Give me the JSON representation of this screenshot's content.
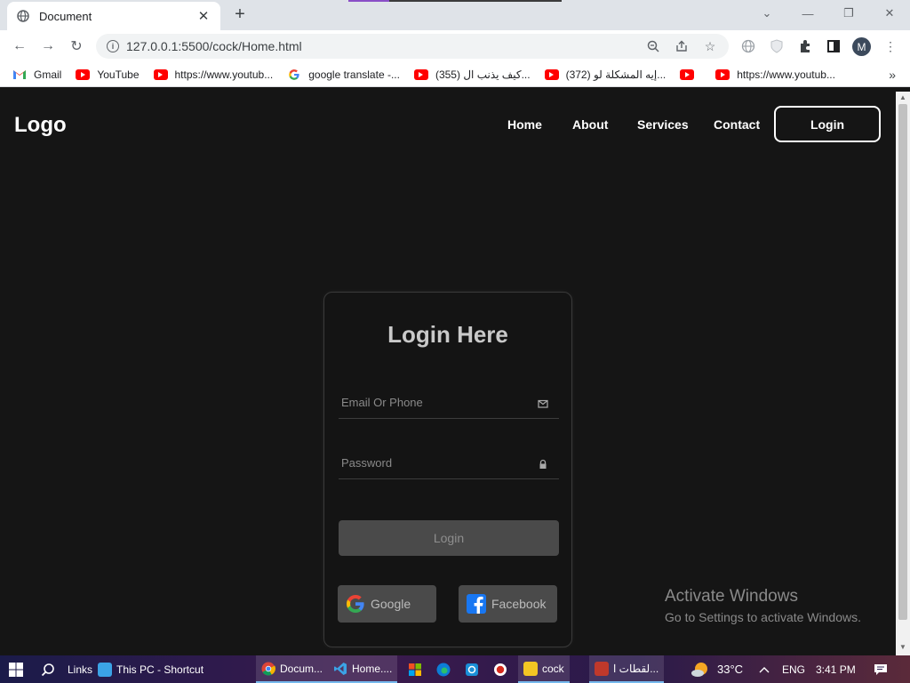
{
  "browser": {
    "tab_title": "Document",
    "url": "127.0.0.1:5500/cock/Home.html",
    "avatar_letter": "M",
    "bookmarks": [
      {
        "label": "Gmail",
        "icon": "gmail-icon"
      },
      {
        "label": "YouTube",
        "icon": "youtube-icon"
      },
      {
        "label": "https://www.youtub...",
        "icon": "youtube-icon"
      },
      {
        "label": "google translate -...",
        "icon": "google-icon"
      },
      {
        "label": "(355) كيف يذنب ال...",
        "icon": "youtube-icon"
      },
      {
        "label": "(372) إيه المشكلة لو...",
        "icon": "youtube-icon"
      },
      {
        "label": "",
        "icon": "youtube-icon"
      },
      {
        "label": "https://www.youtub...",
        "icon": "youtube-icon"
      }
    ]
  },
  "page": {
    "logo": "Logo",
    "nav": [
      "Home",
      "About",
      "Services",
      "Contact"
    ],
    "nav_login": "Login",
    "card": {
      "title": "Login Here",
      "email_placeholder": "Email Or Phone",
      "password_placeholder": "Password",
      "login_button": "Login",
      "google_label": "Google",
      "facebook_label": "Facebook"
    },
    "watermark": {
      "line1": "Activate Windows",
      "line2": "Go to Settings to activate Windows."
    }
  },
  "taskbar": {
    "links": "Links",
    "this_pc": "This PC - Shortcut",
    "apps": [
      {
        "label": "Docum...",
        "icon": "chrome-icon"
      },
      {
        "label": "Home....",
        "icon": "vscode-icon"
      },
      {
        "label": "cock",
        "icon": "folder-icon"
      },
      {
        "label": "لقطات ا...",
        "icon": "snip-icon"
      }
    ],
    "temperature": "33°C",
    "language": "ENG",
    "time": "3:41 PM"
  },
  "colors": {
    "page_bg": "#151515",
    "card_bg": "#141414",
    "button_bg": "#4a4a4a"
  }
}
